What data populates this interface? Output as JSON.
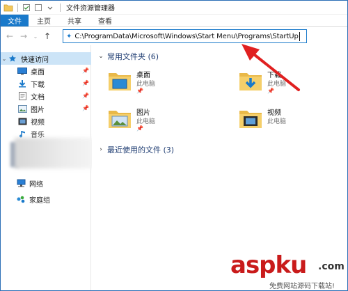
{
  "window": {
    "title": "文件资源管理器"
  },
  "ribbon": {
    "tabs": [
      "文件",
      "主页",
      "共享",
      "查看"
    ]
  },
  "address": {
    "path": "C:\\ProgramData\\Microsoft\\Windows\\Start Menu\\Programs\\StartUp"
  },
  "sidebar": {
    "quick_access": "快速访问",
    "items": [
      {
        "label": "桌面",
        "icon": "desktop-icon"
      },
      {
        "label": "下载",
        "icon": "download-icon"
      },
      {
        "label": "文档",
        "icon": "document-icon"
      },
      {
        "label": "图片",
        "icon": "pictures-icon"
      },
      {
        "label": "视频",
        "icon": "video-icon"
      },
      {
        "label": "音乐",
        "icon": "music-icon"
      }
    ],
    "network": "网络",
    "homegroup": "家庭组"
  },
  "content": {
    "frequent_header": "常用文件夹 (6)",
    "recent_header": "最近使用的文件 (3)",
    "folders": [
      {
        "name": "桌面",
        "location": "此电脑"
      },
      {
        "name": "下载",
        "location": "此电脑"
      },
      {
        "name": "图片",
        "location": "此电脑"
      },
      {
        "name": "视频",
        "location": "此电脑"
      }
    ]
  },
  "watermark": {
    "brand": "aspku",
    "suffix": ".com",
    "tagline": "免费网站源码下载站!"
  },
  "colors": {
    "accent": "#1979ca",
    "selected": "#cce4f7",
    "annotation": "#e02020",
    "folder": "#f3c75a"
  }
}
